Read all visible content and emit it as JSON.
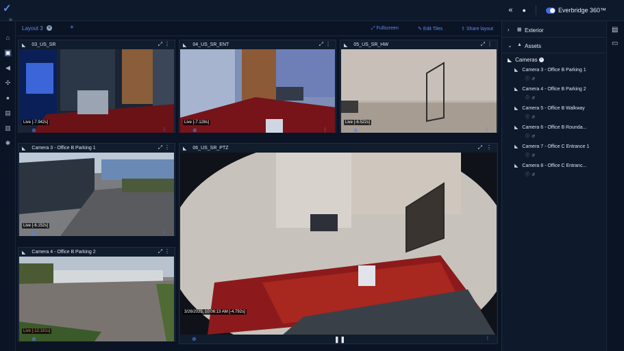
{
  "header": {
    "collapse_icon": "double-chevron-left-icon",
    "brand": "Everbridge 360™",
    "colors": {
      "accent": "#3b6fe0",
      "background": "#0b1424",
      "panel": "#0e1a2c"
    }
  },
  "tabs": [
    {
      "label": "Layout 3"
    }
  ],
  "toolbar": {
    "fullscreen": "Fullscreen",
    "edit_tiles": "Edit Tiles",
    "share_layout": "Share layout"
  },
  "tiles": [
    {
      "name": "03_US_SR",
      "live": "Live [-7.942s]"
    },
    {
      "name": "04_US_SR_ENT",
      "live": "Live [-7.128s]"
    },
    {
      "name": "05_US_SR_HW",
      "live": "Live [-6.522s]"
    },
    {
      "name": "Camera 3 - Office B Parking 1",
      "live": "Live [-6.152s]"
    },
    {
      "name": "06_US_SR_PTZ",
      "live": "3/26/2025, 10:06:13 AM [-4.792s]"
    },
    {
      "name": "Camera 4 - Office B Parking 2",
      "live": "Live [-12.181s]"
    }
  ],
  "right_panel": {
    "exterior": "Exterior",
    "assets": "Assets",
    "cameras_label": "Cameras",
    "cameras": [
      "Camera 3 - Office B Parking 1",
      "Camera 4 - Office B Parking 2",
      "Camera 5 - Office B Walkway",
      "Camera 6 - Office B Rounda...",
      "Camera 7 - Office C Entrance 1",
      "Camera 8 - Office C Entranc..."
    ]
  }
}
